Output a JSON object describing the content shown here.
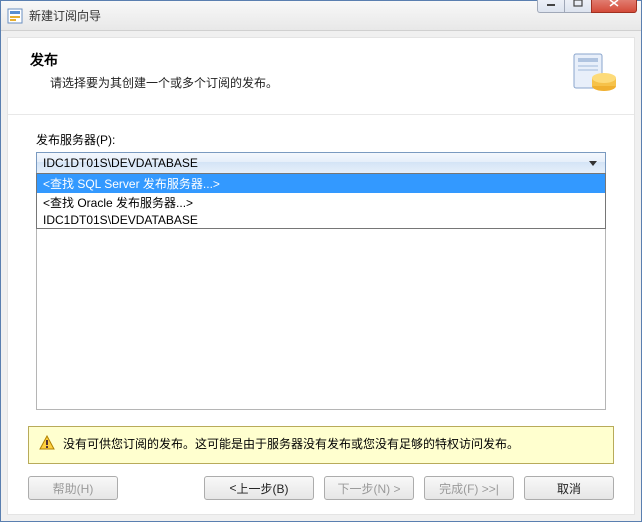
{
  "window": {
    "title": "新建订阅向导"
  },
  "header": {
    "title": "发布",
    "subtitle": "请选择要为其创建一个或多个订阅的发布。"
  },
  "publisher": {
    "label": "发布服务器(P):",
    "selected": "IDC1DT01S\\DEVDATABASE",
    "options": [
      "<查找 SQL Server 发布服务器...>",
      "<查找 Oracle 发布服务器...>",
      "IDC1DT01S\\DEVDATABASE"
    ]
  },
  "info": {
    "message": "没有可供您订阅的发布。这可能是由于服务器没有发布或您没有足够的特权访问发布。"
  },
  "buttons": {
    "help": "帮助(H)",
    "back": "上一步(B)",
    "next": "下一步(N) >",
    "finish": "完成(F) >>|",
    "cancel": "取消"
  },
  "colors": {
    "highlight": "#3399ff",
    "info_bg": "#ffffcf"
  }
}
